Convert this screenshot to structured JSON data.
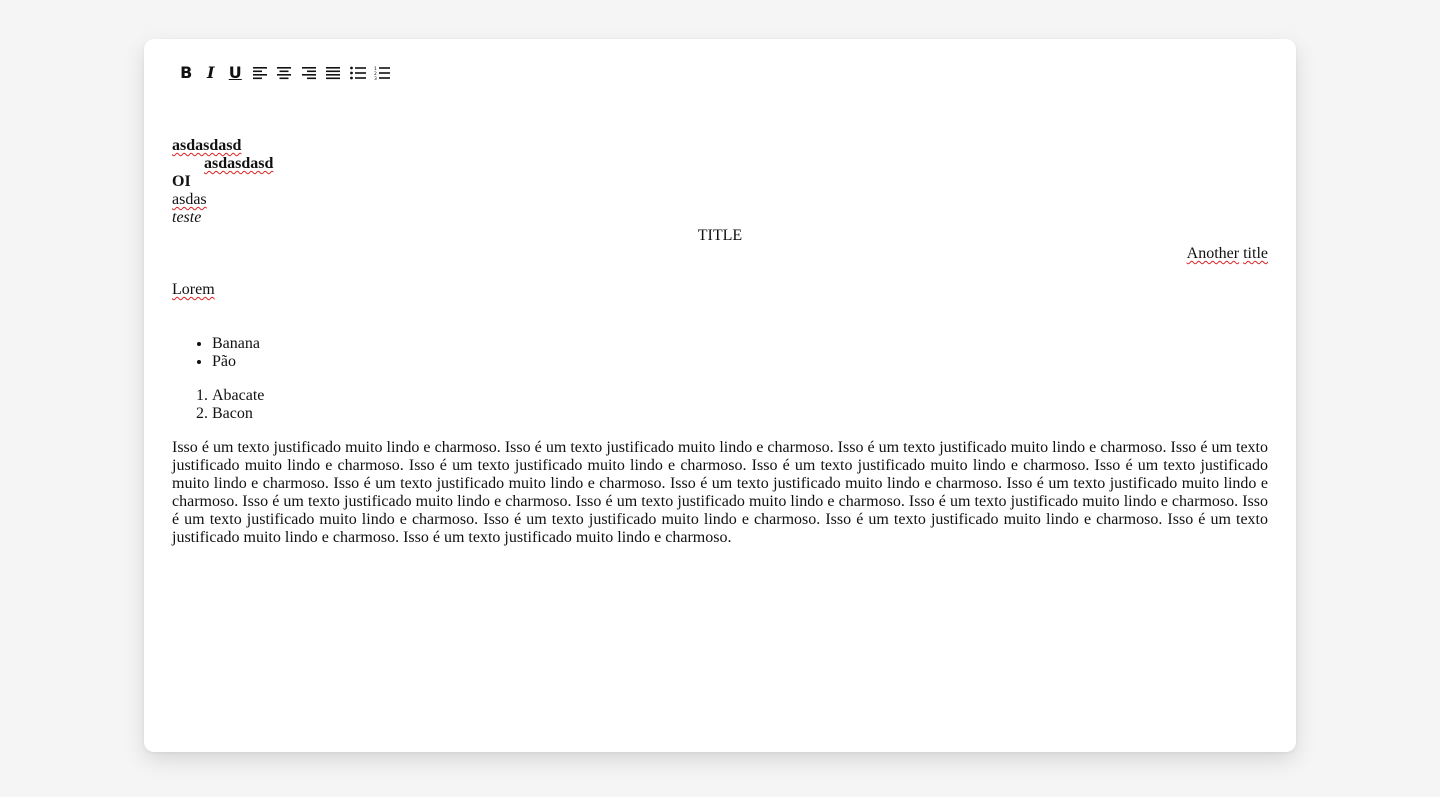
{
  "toolbar": {
    "buttons": [
      {
        "name": "bold-button",
        "label": "B",
        "icon": "bold-icon"
      },
      {
        "name": "italic-button",
        "label": "I",
        "icon": "italic-icon"
      },
      {
        "name": "underline-button",
        "label": "U",
        "icon": "underline-icon"
      },
      {
        "name": "align-left-button",
        "icon": "align-left-icon"
      },
      {
        "name": "align-center-button",
        "icon": "align-center-icon"
      },
      {
        "name": "align-right-button",
        "icon": "align-right-icon"
      },
      {
        "name": "align-justify-button",
        "icon": "align-justify-icon"
      },
      {
        "name": "bullet-list-button",
        "icon": "bullet-list-icon"
      },
      {
        "name": "numbered-list-button",
        "icon": "numbered-list-icon"
      }
    ]
  },
  "editor": {
    "line1": "asdasdasd",
    "line2": "asdasdasd",
    "line3": "OI",
    "line4": "asdas",
    "line5": "teste",
    "title_center": "TITLE",
    "title_right_word1": "Another",
    "title_right_word2": "title",
    "lorem": "Lorem",
    "bullets": [
      "Banana",
      "Pão"
    ],
    "numbered": [
      "Abacate",
      "Bacon"
    ],
    "paragraph": "Isso é um texto justificado muito lindo e charmoso. Isso é um texto justificado muito lindo e charmoso. Isso é um texto justificado muito lindo e charmoso. Isso é um texto justificado muito lindo e charmoso. Isso é um texto justificado muito lindo e charmoso. Isso é um texto justificado muito lindo e charmoso. Isso é um texto justificado muito lindo e charmoso. Isso é um texto justificado muito lindo e charmoso. Isso é um texto justificado muito lindo e charmoso. Isso é um texto justificado muito lindo e charmoso. Isso é um texto justificado muito lindo e charmoso. Isso é um texto justificado muito lindo e charmoso. Isso é um texto justificado muito lindo e charmoso. Isso é um texto justificado muito lindo e charmoso. Isso é um texto justificado muito lindo e charmoso. Isso é um texto justificado muito lindo e charmoso. Isso é um texto justificado muito lindo e charmoso. Isso é um texto justificado muito lindo e charmoso."
  },
  "colors": {
    "page_background": "#f5f5f5",
    "card_background": "#ffffff",
    "text": "#111111",
    "spellcheck_underline": "#dd2222"
  }
}
